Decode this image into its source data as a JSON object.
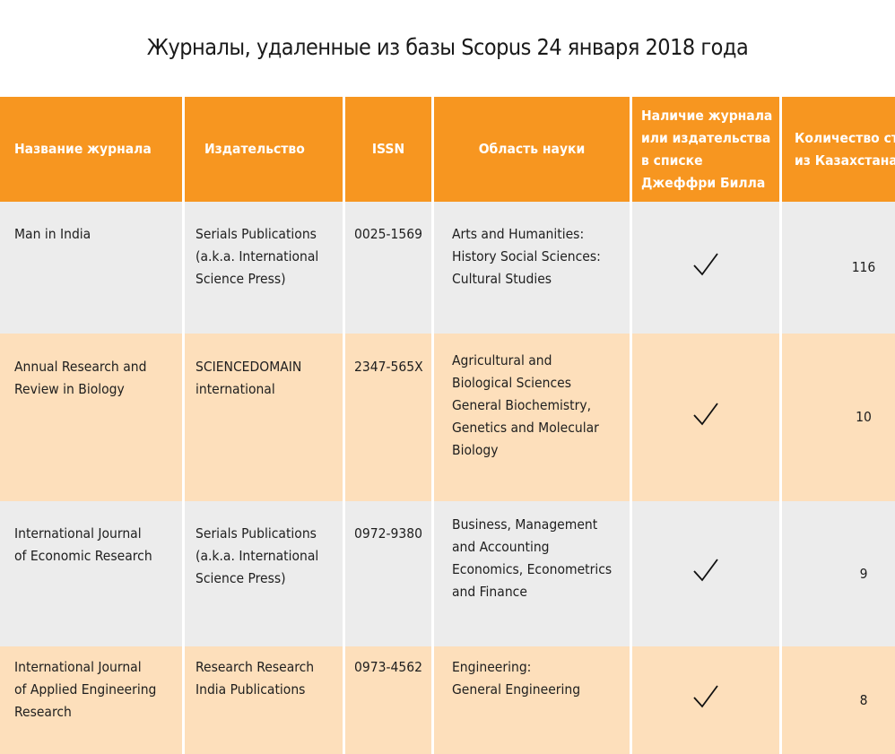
{
  "title": "Журналы, удаленные из базы Scopus 24 января 2018 года",
  "colors": {
    "header_bg": "#f79620",
    "row_grey": "#ececec",
    "row_peach": "#fddfbb"
  },
  "table": {
    "headers": [
      "Название журнала",
      "Издательство",
      "ISSN",
      "Область науки",
      "Наличие журнала\nили издательства\nв списке\nДжеффри Билла",
      "Количество статей\nиз Казахстана"
    ],
    "rows": [
      {
        "name": "Man in India",
        "publisher": "Serials Publications\n(a.k.a. International\nScience Press)",
        "issn": "0025-1569",
        "area": "Arts and Humanities:\nHistory Social Sciences:\nCultural Studies",
        "in_beall_list": "check-icon",
        "kz_articles": "116"
      },
      {
        "name": "Annual Research and\nReview in Biology",
        "publisher": "SCIENCEDOMAIN\ninternational",
        "issn": "2347-565X",
        "area": "Agricultural and\nBiological Sciences\nGeneral Biochemistry,\nGenetics and Molecular\nBiology",
        "in_beall_list": "check-icon",
        "kz_articles": "10"
      },
      {
        "name": "International Journal\nof Economic Research",
        "publisher": "Serials Publications\n(a.k.a. International\nScience Press)",
        "issn": "0972-9380",
        "area": "Business, Management\nand Accounting\nEconomics, Econometrics\nand Finance",
        "in_beall_list": "check-icon",
        "kz_articles": "9"
      },
      {
        "name": "International Journal\nof Applied Engineering\nResearch",
        "publisher": "Research  Research\nIndia Publications",
        "issn": "0973-4562",
        "area": "Engineering:\nGeneral Engineering",
        "in_beall_list": "check-icon",
        "kz_articles": "8"
      }
    ]
  }
}
